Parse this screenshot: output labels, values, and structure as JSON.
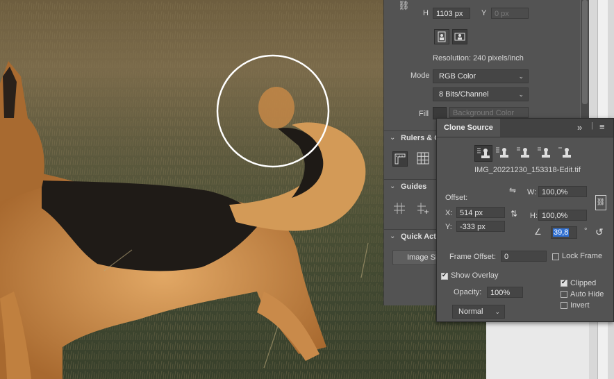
{
  "image_size": {
    "h_label": "H",
    "h_value": "1103 px",
    "y_label": "Y",
    "y_placeholder": "0 px",
    "resolution": "Resolution: 240 pixels/inch",
    "mode_label": "Mode",
    "mode_value": "RGB Color",
    "depth_value": "8 Bits/Channel",
    "fill_label": "Fill",
    "fill_value": "Background Color"
  },
  "sections": {
    "rulers": "Rulers & G",
    "guides": "Guides",
    "quick_actions": "Quick Acti",
    "image_size_btn": "Image Si"
  },
  "clone_source": {
    "tab_title": "Clone Source",
    "file_name": "IMG_20221230_153318-Edit.tif",
    "offset_label": "Offset:",
    "x_label": "X:",
    "x_value": "514 px",
    "y_label": "Y:",
    "y_value": "-333 px",
    "w_label": "W:",
    "w_value": "100,0%",
    "h_label": "H:",
    "h_value": "100,0%",
    "angle_value": "39,8",
    "degree": "°",
    "frame_offset_label": "Frame Offset:",
    "frame_offset_value": "0",
    "lock_frame": "Lock Frame",
    "show_overlay": "Show Overlay",
    "opacity_label": "Opacity:",
    "opacity_value": "100%",
    "blend_mode": "Normal",
    "clipped": "Clipped",
    "auto_hide": "Auto Hide",
    "invert": "Invert"
  },
  "checkbox_states": {
    "lock_frame": false,
    "show_overlay": true,
    "clipped": true,
    "auto_hide": false,
    "invert": false
  },
  "colors": {
    "panel_bg": "#535353",
    "accent_selection": "#2f6fd1",
    "dog_tan": "#c98a4a",
    "dog_black": "#1e1a16"
  }
}
